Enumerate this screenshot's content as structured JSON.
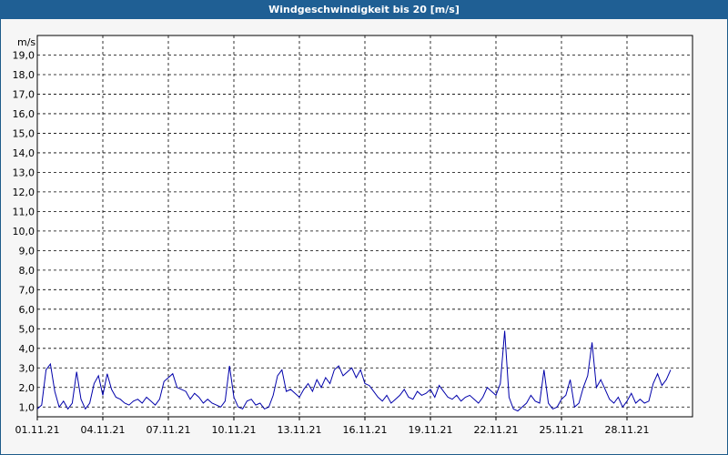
{
  "window": {
    "title": "Windgeschwindigkeit bis 20 [m/s]"
  },
  "chart_data": {
    "type": "line",
    "title": "Windgeschwindigkeit bis 20 [m/s]",
    "ylabel": "m/s",
    "ylim": [
      0.5,
      20.0
    ],
    "x_start": "01.11.21",
    "x_end": "30.11.21",
    "x_tick_labels": [
      "01.11.21",
      "04.11.21",
      "07.11.21",
      "10.11.21",
      "13.11.21",
      "16.11.21",
      "19.11.21",
      "22.11.21",
      "25.11.21",
      "28.11.21"
    ],
    "y_tick_labels": [
      "1,0",
      "2,0",
      "3,0",
      "4,0",
      "5,0",
      "6,0",
      "7,0",
      "8,0",
      "9,0",
      "10,0",
      "11,0",
      "12,0",
      "13,0",
      "14,0",
      "15,0",
      "16,0",
      "17,0",
      "18,0",
      "19,0"
    ],
    "grid": true,
    "line_color": "#0000aa",
    "series": [
      {
        "x_days": [
          0,
          0.2,
          0.4,
          0.6,
          0.8,
          1,
          1.2,
          1.4,
          1.6,
          1.8,
          2,
          2.2,
          2.4,
          2.6,
          2.8,
          3,
          3.2,
          3.4,
          3.6,
          3.8,
          4,
          4.2,
          4.4,
          4.6,
          4.8,
          5,
          5.2,
          5.4,
          5.6,
          5.8,
          6,
          6.2,
          6.4,
          6.6,
          6.8,
          7,
          7.2,
          7.4,
          7.6,
          7.8,
          8,
          8.2,
          8.4,
          8.6,
          8.8,
          9,
          9.2,
          9.4,
          9.6,
          9.8,
          10,
          10.2,
          10.4,
          10.6,
          10.8,
          11,
          11.2,
          11.4,
          11.6,
          11.8,
          12,
          12.2,
          12.4,
          12.6,
          12.8,
          13,
          13.2,
          13.4,
          13.6,
          13.8,
          14,
          14.2,
          14.4,
          14.6,
          14.8,
          15,
          15.2,
          15.4,
          15.6,
          15.8,
          16,
          16.2,
          16.4,
          16.6,
          16.8,
          17,
          17.2,
          17.4,
          17.6,
          17.8,
          18,
          18.2,
          18.4,
          18.6,
          18.8,
          19,
          19.2,
          19.4,
          19.6,
          19.8,
          20,
          20.2,
          20.4,
          20.6,
          20.8,
          21,
          21.2,
          21.4,
          21.6,
          21.8,
          22,
          22.2,
          22.4,
          22.6,
          22.8,
          23,
          23.2,
          23.4,
          23.6,
          23.8,
          24,
          24.2,
          24.4,
          24.6,
          24.8,
          25,
          25.2,
          25.4,
          25.6,
          25.8,
          26,
          26.2,
          26.4,
          26.6,
          26.8,
          27,
          27.2,
          27.4,
          27.6,
          27.8,
          28,
          28.2,
          28.4,
          28.6,
          28.8,
          29,
          29.2,
          29.4,
          29.6,
          29.8,
          30
        ],
        "values": [
          0.9,
          1.1,
          2.9,
          3.2,
          1.8,
          1.0,
          1.3,
          0.9,
          1.2,
          2.8,
          1.4,
          0.9,
          1.2,
          2.2,
          2.6,
          1.6,
          2.7,
          1.9,
          1.5,
          1.4,
          1.2,
          1.1,
          1.3,
          1.4,
          1.2,
          1.5,
          1.3,
          1.1,
          1.4,
          2.3,
          2.5,
          2.7,
          2.0,
          1.9,
          1.8,
          1.4,
          1.7,
          1.5,
          1.2,
          1.4,
          1.2,
          1.1,
          1.0,
          1.3,
          3.1,
          1.5,
          1.0,
          0.9,
          1.3,
          1.4,
          1.1,
          1.2,
          0.9,
          1.0,
          1.6,
          2.6,
          2.9,
          1.8,
          1.9,
          1.7,
          1.5,
          1.9,
          2.2,
          1.8,
          2.4,
          2.0,
          2.5,
          2.2,
          2.9,
          3.1,
          2.6,
          2.8,
          3.0,
          2.5,
          2.9,
          2.2,
          2.1,
          1.8,
          1.5,
          1.3,
          1.6,
          1.2,
          1.4,
          1.6,
          1.9,
          1.5,
          1.4,
          1.8,
          1.6,
          1.7,
          1.9,
          1.5,
          2.1,
          1.8,
          1.5,
          1.4,
          1.6,
          1.3,
          1.5,
          1.6,
          1.4,
          1.2,
          1.5,
          2.0,
          1.8,
          1.6,
          2.2,
          4.9,
          1.5,
          0.9,
          0.8,
          1.0,
          1.2,
          1.6,
          1.3,
          1.2,
          2.9,
          1.2,
          0.9,
          1.0,
          1.4,
          1.6,
          2.4,
          1.0,
          1.2,
          2.0,
          2.6,
          4.3,
          2.0,
          2.4,
          1.9,
          1.4,
          1.2,
          1.5,
          1.0,
          1.3,
          1.7,
          1.2,
          1.4,
          1.2,
          1.3,
          2.2,
          2.7,
          2.1,
          2.4,
          2.9
        ]
      }
    ]
  }
}
